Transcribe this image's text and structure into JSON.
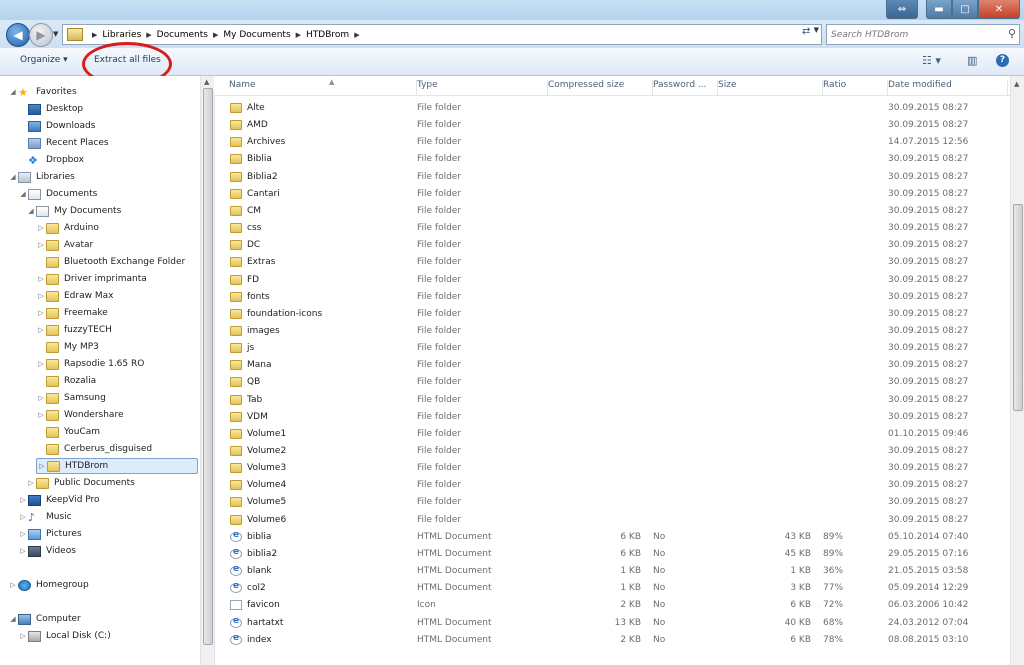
{
  "window": {
    "resize_glyph": "⇔",
    "min_glyph": "▬",
    "max_glyph": "□",
    "close_glyph": "✕"
  },
  "address": {
    "back_glyph": "◀",
    "fwd_glyph": "▶",
    "dropdown_glyph": "▼",
    "breadcrumbs": [
      "Libraries",
      "Documents",
      "My Documents",
      "HTDBrom"
    ],
    "separator_glyph": "▶",
    "refresh_glyph": "⇄",
    "search_placeholder": "Search HTDBrom",
    "search_glyph": "⚲"
  },
  "toolbar": {
    "organize": "Organize ▾",
    "extract": "Extract all files",
    "views_glyph": "☷ ▾",
    "preview_glyph": "▥",
    "help_glyph": "?"
  },
  "nav": {
    "items": [
      {
        "label": "Favorites",
        "icon": "star",
        "arrow": "◢",
        "indent": 0
      },
      {
        "label": "Desktop",
        "icon": "desktop",
        "arrow": "",
        "indent": 1
      },
      {
        "label": "Downloads",
        "icon": "download",
        "arrow": "",
        "indent": 1
      },
      {
        "label": "Recent Places",
        "icon": "recent",
        "arrow": "",
        "indent": 1
      },
      {
        "label": "Dropbox",
        "icon": "dropbox",
        "arrow": "",
        "indent": 1
      },
      {
        "label": "Libraries",
        "icon": "libraries",
        "arrow": "◢",
        "indent": 0
      },
      {
        "label": "Documents",
        "icon": "docs",
        "arrow": "◢",
        "indent": 1
      },
      {
        "label": "My Documents",
        "icon": "docs",
        "arrow": "◢",
        "indent": 2
      },
      {
        "label": "Arduino",
        "icon": "folder",
        "arrow": "▷",
        "indent": 3
      },
      {
        "label": "Avatar",
        "icon": "folder",
        "arrow": "▷",
        "indent": 3
      },
      {
        "label": "Bluetooth Exchange Folder",
        "icon": "folder",
        "arrow": "",
        "indent": 3
      },
      {
        "label": "Driver imprimanta",
        "icon": "folder",
        "arrow": "▷",
        "indent": 3
      },
      {
        "label": "Edraw Max",
        "icon": "folder",
        "arrow": "▷",
        "indent": 3
      },
      {
        "label": "Freemake",
        "icon": "folder",
        "arrow": "▷",
        "indent": 3
      },
      {
        "label": "fuzzyTECH",
        "icon": "folder",
        "arrow": "▷",
        "indent": 3
      },
      {
        "label": "My MP3",
        "icon": "folder",
        "arrow": "",
        "indent": 3
      },
      {
        "label": "Rapsodie 1.65 RO",
        "icon": "folder",
        "arrow": "▷",
        "indent": 3
      },
      {
        "label": "Rozalia",
        "icon": "folder",
        "arrow": "",
        "indent": 3
      },
      {
        "label": "Samsung",
        "icon": "folder",
        "arrow": "▷",
        "indent": 3
      },
      {
        "label": "Wondershare",
        "icon": "folder",
        "arrow": "▷",
        "indent": 3
      },
      {
        "label": "YouCam",
        "icon": "folder",
        "arrow": "",
        "indent": 3
      },
      {
        "label": "Cerberus_disguised",
        "icon": "folder",
        "arrow": "",
        "indent": 3
      },
      {
        "label": "HTDBrom",
        "icon": "folder",
        "arrow": "▷",
        "indent": 3,
        "selected": true
      },
      {
        "label": "Public Documents",
        "icon": "folder",
        "arrow": "▷",
        "indent": 2
      },
      {
        "label": "KeepVid Pro",
        "icon": "keepvid",
        "arrow": "▷",
        "indent": 1
      },
      {
        "label": "Music",
        "icon": "music",
        "arrow": "▷",
        "indent": 1
      },
      {
        "label": "Pictures",
        "icon": "pictures",
        "arrow": "▷",
        "indent": 1
      },
      {
        "label": "Videos",
        "icon": "videos",
        "arrow": "▷",
        "indent": 1
      },
      {
        "label": "Homegroup",
        "icon": "homegroup",
        "arrow": "▷",
        "indent": 0,
        "gap": true
      },
      {
        "label": "Computer",
        "icon": "computer",
        "arrow": "◢",
        "indent": 0,
        "gap": true
      },
      {
        "label": "Local Disk (C:)",
        "icon": "disk",
        "arrow": "▷",
        "indent": 1
      }
    ]
  },
  "columns": [
    "Name",
    "Type",
    "Compressed size",
    "Password ...",
    "Size",
    "Ratio",
    "Date modified"
  ],
  "sort_glyph": "▲",
  "files": [
    {
      "name": "Alte",
      "type": "File folder",
      "csize": "",
      "pwd": "",
      "size": "",
      "ratio": "",
      "date": "30.09.2015 08:27",
      "icon": "folder"
    },
    {
      "name": "AMD",
      "type": "File folder",
      "csize": "",
      "pwd": "",
      "size": "",
      "ratio": "",
      "date": "30.09.2015 08:27",
      "icon": "folder"
    },
    {
      "name": "Archives",
      "type": "File folder",
      "csize": "",
      "pwd": "",
      "size": "",
      "ratio": "",
      "date": "14.07.2015 12:56",
      "icon": "folder"
    },
    {
      "name": "Biblia",
      "type": "File folder",
      "csize": "",
      "pwd": "",
      "size": "",
      "ratio": "",
      "date": "30.09.2015 08:27",
      "icon": "folder"
    },
    {
      "name": "Biblia2",
      "type": "File folder",
      "csize": "",
      "pwd": "",
      "size": "",
      "ratio": "",
      "date": "30.09.2015 08:27",
      "icon": "folder"
    },
    {
      "name": "Cantari",
      "type": "File folder",
      "csize": "",
      "pwd": "",
      "size": "",
      "ratio": "",
      "date": "30.09.2015 08:27",
      "icon": "folder"
    },
    {
      "name": "CM",
      "type": "File folder",
      "csize": "",
      "pwd": "",
      "size": "",
      "ratio": "",
      "date": "30.09.2015 08:27",
      "icon": "folder"
    },
    {
      "name": "css",
      "type": "File folder",
      "csize": "",
      "pwd": "",
      "size": "",
      "ratio": "",
      "date": "30.09.2015 08:27",
      "icon": "folder"
    },
    {
      "name": "DC",
      "type": "File folder",
      "csize": "",
      "pwd": "",
      "size": "",
      "ratio": "",
      "date": "30.09.2015 08:27",
      "icon": "folder"
    },
    {
      "name": "Extras",
      "type": "File folder",
      "csize": "",
      "pwd": "",
      "size": "",
      "ratio": "",
      "date": "30.09.2015 08:27",
      "icon": "folder"
    },
    {
      "name": "FD",
      "type": "File folder",
      "csize": "",
      "pwd": "",
      "size": "",
      "ratio": "",
      "date": "30.09.2015 08:27",
      "icon": "folder"
    },
    {
      "name": "fonts",
      "type": "File folder",
      "csize": "",
      "pwd": "",
      "size": "",
      "ratio": "",
      "date": "30.09.2015 08:27",
      "icon": "folder"
    },
    {
      "name": "foundation-icons",
      "type": "File folder",
      "csize": "",
      "pwd": "",
      "size": "",
      "ratio": "",
      "date": "30.09.2015 08:27",
      "icon": "folder"
    },
    {
      "name": "images",
      "type": "File folder",
      "csize": "",
      "pwd": "",
      "size": "",
      "ratio": "",
      "date": "30.09.2015 08:27",
      "icon": "folder"
    },
    {
      "name": "js",
      "type": "File folder",
      "csize": "",
      "pwd": "",
      "size": "",
      "ratio": "",
      "date": "30.09.2015 08:27",
      "icon": "folder"
    },
    {
      "name": "Mana",
      "type": "File folder",
      "csize": "",
      "pwd": "",
      "size": "",
      "ratio": "",
      "date": "30.09.2015 08:27",
      "icon": "folder"
    },
    {
      "name": "QB",
      "type": "File folder",
      "csize": "",
      "pwd": "",
      "size": "",
      "ratio": "",
      "date": "30.09.2015 08:27",
      "icon": "folder"
    },
    {
      "name": "Tab",
      "type": "File folder",
      "csize": "",
      "pwd": "",
      "size": "",
      "ratio": "",
      "date": "30.09.2015 08:27",
      "icon": "folder"
    },
    {
      "name": "VDM",
      "type": "File folder",
      "csize": "",
      "pwd": "",
      "size": "",
      "ratio": "",
      "date": "30.09.2015 08:27",
      "icon": "folder"
    },
    {
      "name": "Volume1",
      "type": "File folder",
      "csize": "",
      "pwd": "",
      "size": "",
      "ratio": "",
      "date": "01.10.2015 09:46",
      "icon": "folder"
    },
    {
      "name": "Volume2",
      "type": "File folder",
      "csize": "",
      "pwd": "",
      "size": "",
      "ratio": "",
      "date": "30.09.2015 08:27",
      "icon": "folder"
    },
    {
      "name": "Volume3",
      "type": "File folder",
      "csize": "",
      "pwd": "",
      "size": "",
      "ratio": "",
      "date": "30.09.2015 08:27",
      "icon": "folder"
    },
    {
      "name": "Volume4",
      "type": "File folder",
      "csize": "",
      "pwd": "",
      "size": "",
      "ratio": "",
      "date": "30.09.2015 08:27",
      "icon": "folder"
    },
    {
      "name": "Volume5",
      "type": "File folder",
      "csize": "",
      "pwd": "",
      "size": "",
      "ratio": "",
      "date": "30.09.2015 08:27",
      "icon": "folder"
    },
    {
      "name": "Volume6",
      "type": "File folder",
      "csize": "",
      "pwd": "",
      "size": "",
      "ratio": "",
      "date": "30.09.2015 08:27",
      "icon": "folder"
    },
    {
      "name": "biblia",
      "type": "HTML Document",
      "csize": "6 KB",
      "pwd": "No",
      "size": "43 KB",
      "ratio": "89%",
      "date": "05.10.2014 07:40",
      "icon": "html"
    },
    {
      "name": "biblia2",
      "type": "HTML Document",
      "csize": "6 KB",
      "pwd": "No",
      "size": "45 KB",
      "ratio": "89%",
      "date": "29.05.2015 07:16",
      "icon": "html"
    },
    {
      "name": "blank",
      "type": "HTML Document",
      "csize": "1 KB",
      "pwd": "No",
      "size": "1 KB",
      "ratio": "36%",
      "date": "21.05.2015 03:58",
      "icon": "html"
    },
    {
      "name": "col2",
      "type": "HTML Document",
      "csize": "1 KB",
      "pwd": "No",
      "size": "3 KB",
      "ratio": "77%",
      "date": "05.09.2014 12:29",
      "icon": "html"
    },
    {
      "name": "favicon",
      "type": "Icon",
      "csize": "2 KB",
      "pwd": "No",
      "size": "6 KB",
      "ratio": "72%",
      "date": "06.03.2006 10:42",
      "icon": "blank"
    },
    {
      "name": "hartatxt",
      "type": "HTML Document",
      "csize": "13 KB",
      "pwd": "No",
      "size": "40 KB",
      "ratio": "68%",
      "date": "24.03.2012 07:04",
      "icon": "html"
    },
    {
      "name": "index",
      "type": "HTML Document",
      "csize": "2 KB",
      "pwd": "No",
      "size": "6 KB",
      "ratio": "78%",
      "date": "08.08.2015 03:10",
      "icon": "html"
    }
  ]
}
